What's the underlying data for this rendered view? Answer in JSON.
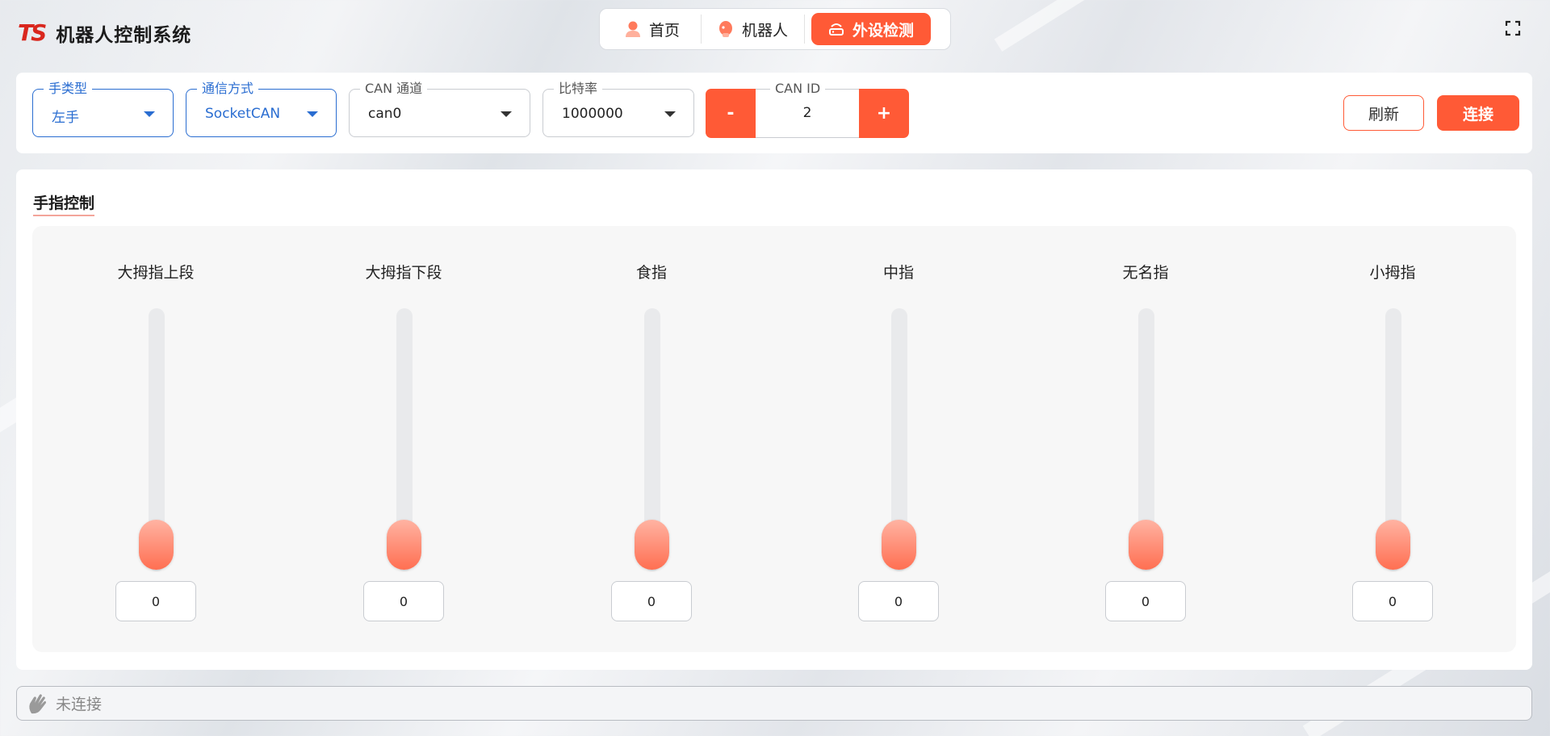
{
  "app": {
    "logo": "TS",
    "title": "机器人控制系统"
  },
  "nav": {
    "items": [
      {
        "label": "首页",
        "icon": "person-icon"
      },
      {
        "label": "机器人",
        "icon": "robot-head-icon"
      },
      {
        "label": "外设检测",
        "icon": "router-icon",
        "active": true
      }
    ]
  },
  "config": {
    "hand_type": {
      "label": "手类型",
      "value": "左手"
    },
    "comm_mode": {
      "label": "通信方式",
      "value": "SocketCAN"
    },
    "can_channel": {
      "label": "CAN 通道",
      "value": "can0"
    },
    "bitrate": {
      "label": "比特率",
      "value": "1000000"
    },
    "can_id": {
      "label": "CAN ID",
      "value": "2",
      "minus": "-",
      "plus": "+"
    },
    "refresh_label": "刷新",
    "connect_label": "连接"
  },
  "finger_control": {
    "title": "手指控制",
    "fingers": [
      {
        "name": "大拇指上段",
        "value": "0"
      },
      {
        "name": "大拇指下段",
        "value": "0"
      },
      {
        "name": "食指",
        "value": "0"
      },
      {
        "name": "中指",
        "value": "0"
      },
      {
        "name": "无名指",
        "value": "0"
      },
      {
        "name": "小拇指",
        "value": "0"
      }
    ]
  },
  "status": {
    "text": "未连接",
    "icon": "hand-wave-icon"
  },
  "colors": {
    "accent": "#ff5a36",
    "brand_red": "#d9271e",
    "focus_blue": "#2a6dd1"
  }
}
